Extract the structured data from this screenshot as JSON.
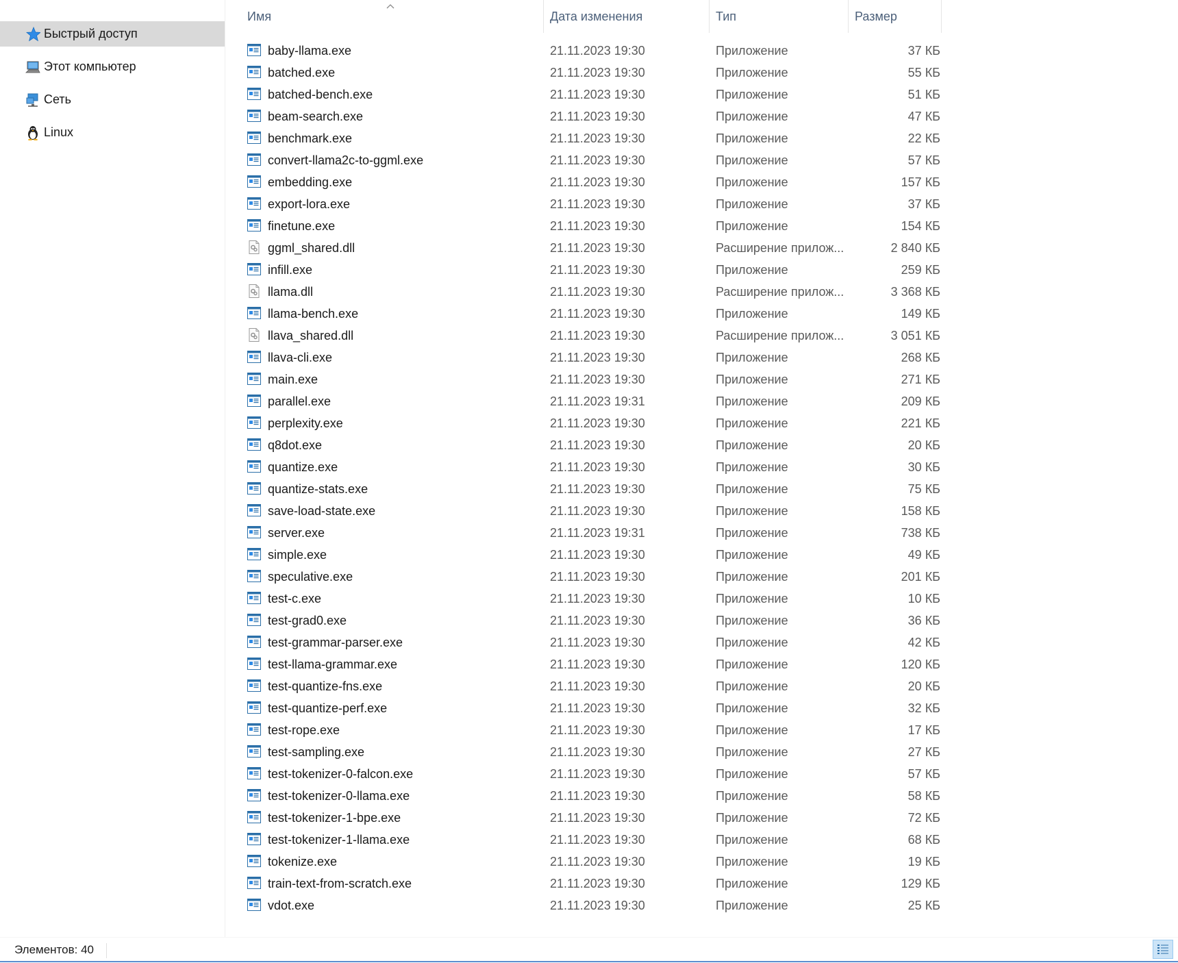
{
  "nav": {
    "items": [
      {
        "label": "Быстрый доступ",
        "icon": "star-icon",
        "selected": true
      },
      {
        "label": "Этот компьютер",
        "icon": "computer-icon",
        "selected": false
      },
      {
        "label": "Сеть",
        "icon": "network-icon",
        "selected": false
      },
      {
        "label": "Linux",
        "icon": "linux-penguin-icon",
        "selected": false
      }
    ]
  },
  "columns": {
    "name": "Имя",
    "date": "Дата изменения",
    "type": "Тип",
    "size": "Размер"
  },
  "files": [
    {
      "name": "baby-llama.exe",
      "date": "21.11.2023 19:30",
      "type": "Приложение",
      "size": "37 КБ",
      "icon": "exe-icon"
    },
    {
      "name": "batched.exe",
      "date": "21.11.2023 19:30",
      "type": "Приложение",
      "size": "55 КБ",
      "icon": "exe-icon"
    },
    {
      "name": "batched-bench.exe",
      "date": "21.11.2023 19:30",
      "type": "Приложение",
      "size": "51 КБ",
      "icon": "exe-icon"
    },
    {
      "name": "beam-search.exe",
      "date": "21.11.2023 19:30",
      "type": "Приложение",
      "size": "47 КБ",
      "icon": "exe-icon"
    },
    {
      "name": "benchmark.exe",
      "date": "21.11.2023 19:30",
      "type": "Приложение",
      "size": "22 КБ",
      "icon": "exe-icon"
    },
    {
      "name": "convert-llama2c-to-ggml.exe",
      "date": "21.11.2023 19:30",
      "type": "Приложение",
      "size": "57 КБ",
      "icon": "exe-icon"
    },
    {
      "name": "embedding.exe",
      "date": "21.11.2023 19:30",
      "type": "Приложение",
      "size": "157 КБ",
      "icon": "exe-icon"
    },
    {
      "name": "export-lora.exe",
      "date": "21.11.2023 19:30",
      "type": "Приложение",
      "size": "37 КБ",
      "icon": "exe-icon"
    },
    {
      "name": "finetune.exe",
      "date": "21.11.2023 19:30",
      "type": "Приложение",
      "size": "154 КБ",
      "icon": "exe-icon"
    },
    {
      "name": "ggml_shared.dll",
      "date": "21.11.2023 19:30",
      "type": "Расширение прилож...",
      "size": "2 840 КБ",
      "icon": "dll-icon"
    },
    {
      "name": "infill.exe",
      "date": "21.11.2023 19:30",
      "type": "Приложение",
      "size": "259 КБ",
      "icon": "exe-icon"
    },
    {
      "name": "llama.dll",
      "date": "21.11.2023 19:30",
      "type": "Расширение прилож...",
      "size": "3 368 КБ",
      "icon": "dll-icon"
    },
    {
      "name": "llama-bench.exe",
      "date": "21.11.2023 19:30",
      "type": "Приложение",
      "size": "149 КБ",
      "icon": "exe-icon"
    },
    {
      "name": "llava_shared.dll",
      "date": "21.11.2023 19:30",
      "type": "Расширение прилож...",
      "size": "3 051 КБ",
      "icon": "dll-icon"
    },
    {
      "name": "llava-cli.exe",
      "date": "21.11.2023 19:30",
      "type": "Приложение",
      "size": "268 КБ",
      "icon": "exe-icon"
    },
    {
      "name": "main.exe",
      "date": "21.11.2023 19:30",
      "type": "Приложение",
      "size": "271 КБ",
      "icon": "exe-icon"
    },
    {
      "name": "parallel.exe",
      "date": "21.11.2023 19:31",
      "type": "Приложение",
      "size": "209 КБ",
      "icon": "exe-icon"
    },
    {
      "name": "perplexity.exe",
      "date": "21.11.2023 19:30",
      "type": "Приложение",
      "size": "221 КБ",
      "icon": "exe-icon"
    },
    {
      "name": "q8dot.exe",
      "date": "21.11.2023 19:30",
      "type": "Приложение",
      "size": "20 КБ",
      "icon": "exe-icon"
    },
    {
      "name": "quantize.exe",
      "date": "21.11.2023 19:30",
      "type": "Приложение",
      "size": "30 КБ",
      "icon": "exe-icon"
    },
    {
      "name": "quantize-stats.exe",
      "date": "21.11.2023 19:30",
      "type": "Приложение",
      "size": "75 КБ",
      "icon": "exe-icon"
    },
    {
      "name": "save-load-state.exe",
      "date": "21.11.2023 19:30",
      "type": "Приложение",
      "size": "158 КБ",
      "icon": "exe-icon"
    },
    {
      "name": "server.exe",
      "date": "21.11.2023 19:31",
      "type": "Приложение",
      "size": "738 КБ",
      "icon": "exe-icon"
    },
    {
      "name": "simple.exe",
      "date": "21.11.2023 19:30",
      "type": "Приложение",
      "size": "49 КБ",
      "icon": "exe-icon"
    },
    {
      "name": "speculative.exe",
      "date": "21.11.2023 19:30",
      "type": "Приложение",
      "size": "201 КБ",
      "icon": "exe-icon"
    },
    {
      "name": "test-c.exe",
      "date": "21.11.2023 19:30",
      "type": "Приложение",
      "size": "10 КБ",
      "icon": "exe-icon"
    },
    {
      "name": "test-grad0.exe",
      "date": "21.11.2023 19:30",
      "type": "Приложение",
      "size": "36 КБ",
      "icon": "exe-icon"
    },
    {
      "name": "test-grammar-parser.exe",
      "date": "21.11.2023 19:30",
      "type": "Приложение",
      "size": "42 КБ",
      "icon": "exe-icon"
    },
    {
      "name": "test-llama-grammar.exe",
      "date": "21.11.2023 19:30",
      "type": "Приложение",
      "size": "120 КБ",
      "icon": "exe-icon"
    },
    {
      "name": "test-quantize-fns.exe",
      "date": "21.11.2023 19:30",
      "type": "Приложение",
      "size": "20 КБ",
      "icon": "exe-icon"
    },
    {
      "name": "test-quantize-perf.exe",
      "date": "21.11.2023 19:30",
      "type": "Приложение",
      "size": "32 КБ",
      "icon": "exe-icon"
    },
    {
      "name": "test-rope.exe",
      "date": "21.11.2023 19:30",
      "type": "Приложение",
      "size": "17 КБ",
      "icon": "exe-icon"
    },
    {
      "name": "test-sampling.exe",
      "date": "21.11.2023 19:30",
      "type": "Приложение",
      "size": "27 КБ",
      "icon": "exe-icon"
    },
    {
      "name": "test-tokenizer-0-falcon.exe",
      "date": "21.11.2023 19:30",
      "type": "Приложение",
      "size": "57 КБ",
      "icon": "exe-icon"
    },
    {
      "name": "test-tokenizer-0-llama.exe",
      "date": "21.11.2023 19:30",
      "type": "Приложение",
      "size": "58 КБ",
      "icon": "exe-icon"
    },
    {
      "name": "test-tokenizer-1-bpe.exe",
      "date": "21.11.2023 19:30",
      "type": "Приложение",
      "size": "72 КБ",
      "icon": "exe-icon"
    },
    {
      "name": "test-tokenizer-1-llama.exe",
      "date": "21.11.2023 19:30",
      "type": "Приложение",
      "size": "68 КБ",
      "icon": "exe-icon"
    },
    {
      "name": "tokenize.exe",
      "date": "21.11.2023 19:30",
      "type": "Приложение",
      "size": "19 КБ",
      "icon": "exe-icon"
    },
    {
      "name": "train-text-from-scratch.exe",
      "date": "21.11.2023 19:30",
      "type": "Приложение",
      "size": "129 КБ",
      "icon": "exe-icon"
    },
    {
      "name": "vdot.exe",
      "date": "21.11.2023 19:30",
      "type": "Приложение",
      "size": "25 КБ",
      "icon": "exe-icon"
    }
  ],
  "status": {
    "items_count": "Элементов: 40"
  },
  "colors": {
    "selection_bg": "#d9d9d9",
    "header_text": "#4c607a",
    "accent": "#5b8ecf"
  }
}
